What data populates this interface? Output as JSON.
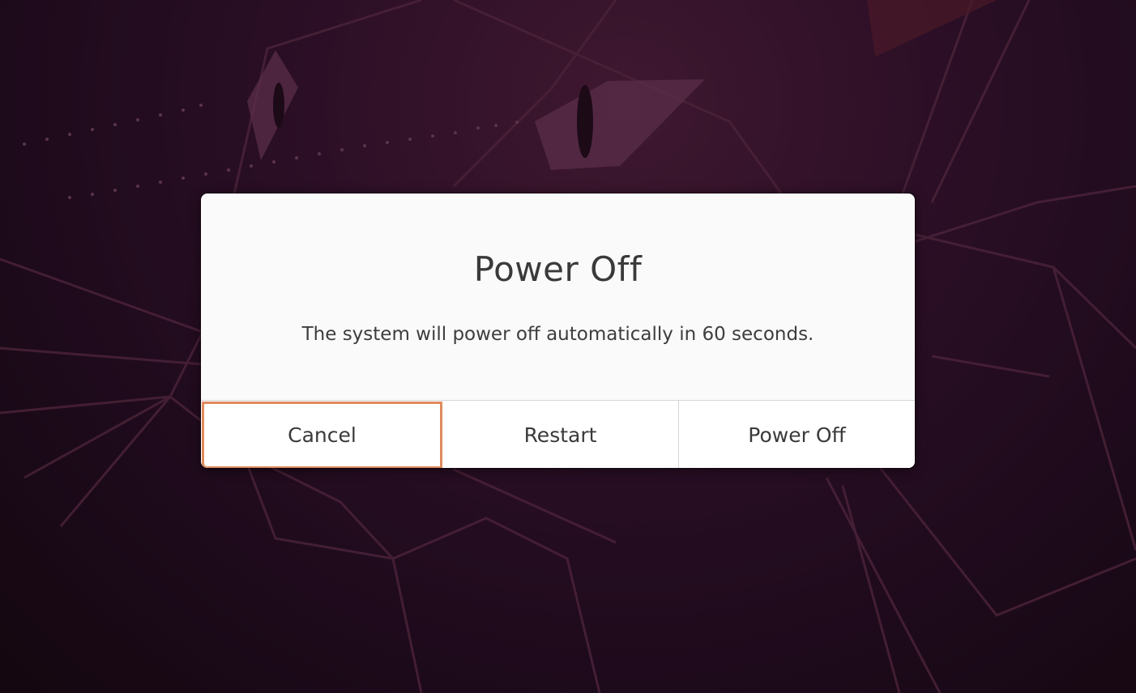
{
  "dialog": {
    "title": "Power Off",
    "message": "The system will power off automatically in 60 seconds.",
    "buttons": {
      "cancel": "Cancel",
      "restart": "Restart",
      "power_off": "Power Off"
    },
    "focused_button": "cancel"
  },
  "colors": {
    "background": "#2c0f26",
    "dialog_background": "#fafafa",
    "focus_ring": "#e08a5e",
    "text": "#3a3a3a"
  }
}
